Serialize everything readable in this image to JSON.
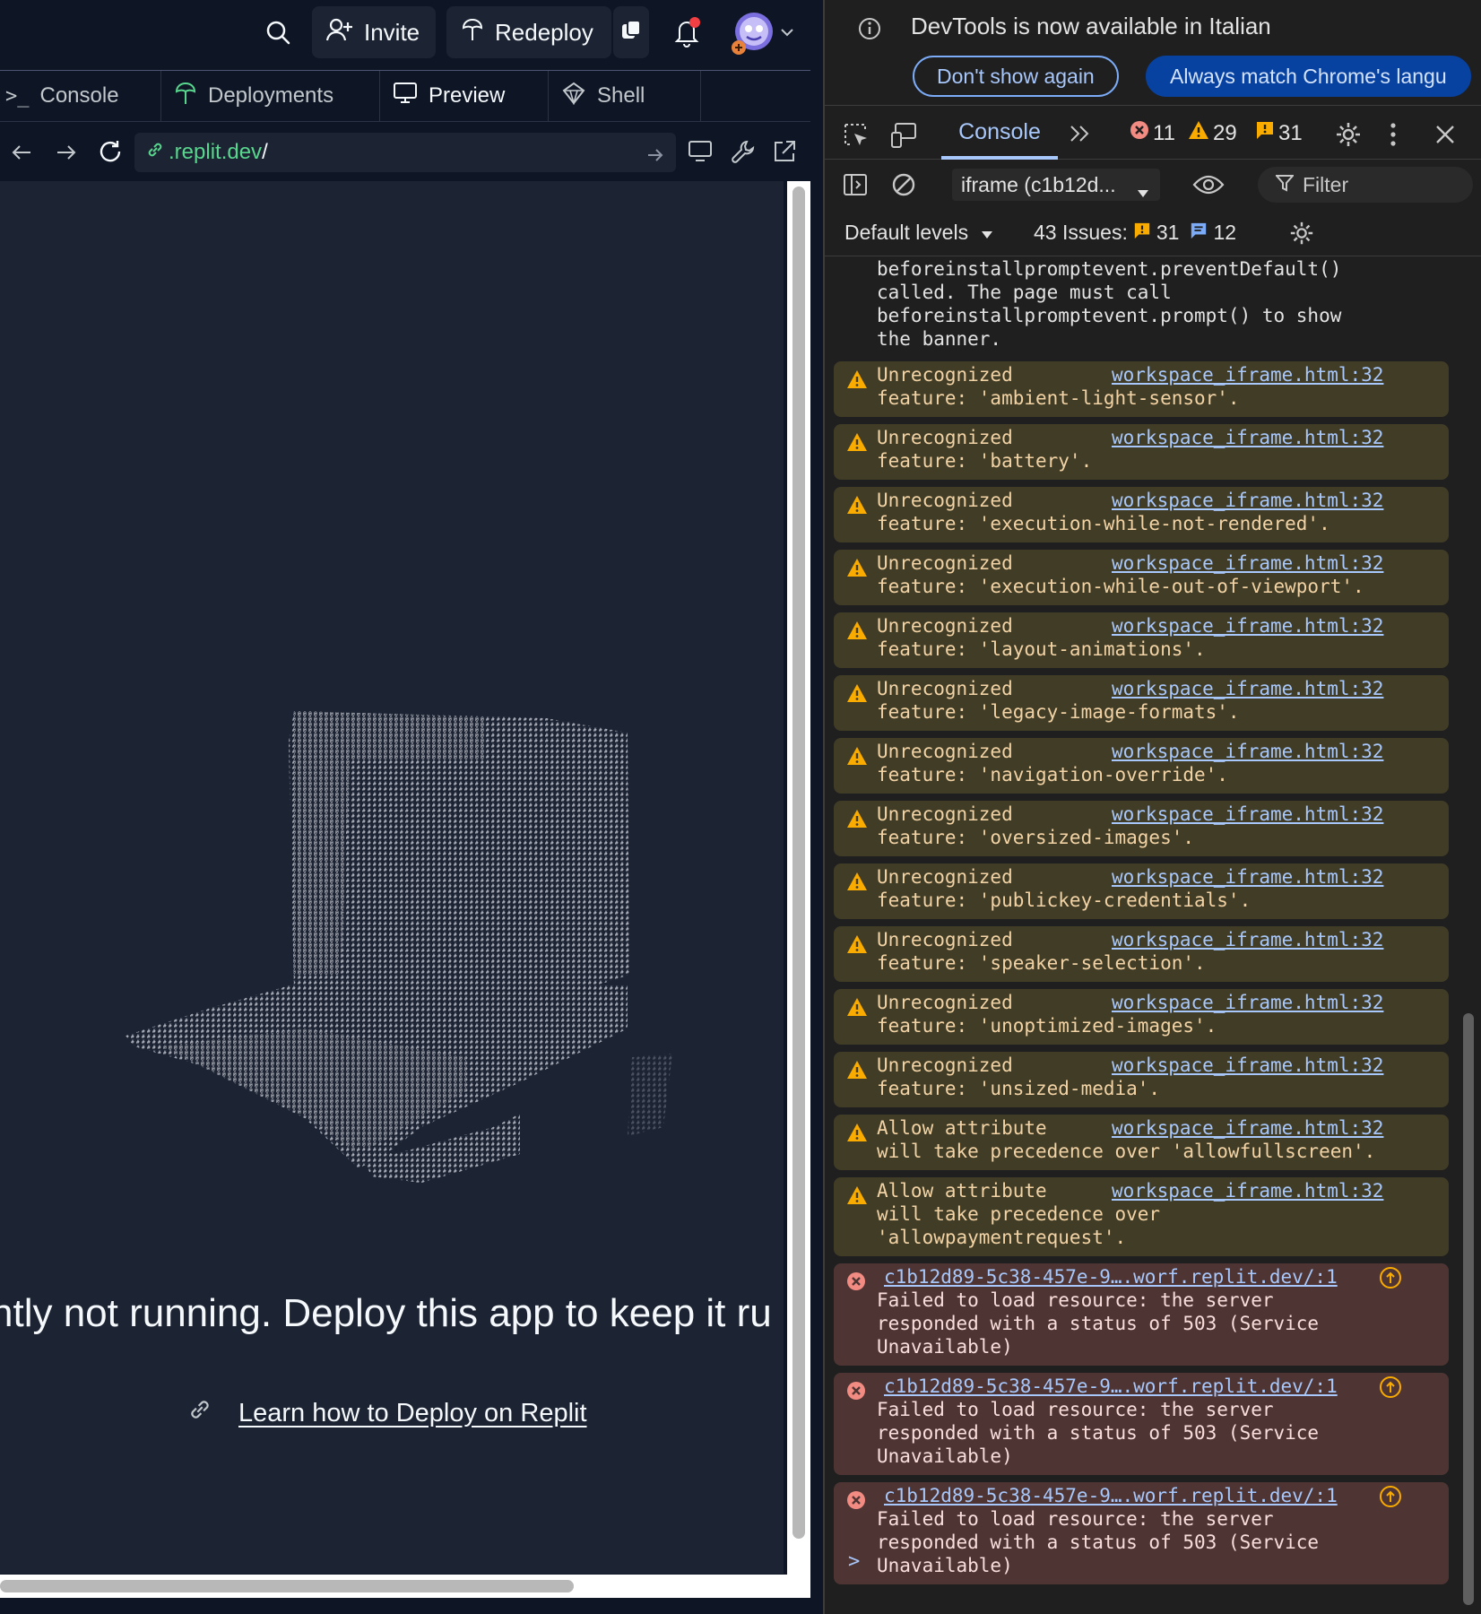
{
  "replit": {
    "topbar": {
      "invite_label": "Invite",
      "redeploy_label": "Redeploy"
    },
    "tabs": [
      {
        "label": "Console",
        "icon": "terminal-icon"
      },
      {
        "label": "Deployments",
        "icon": "deployments-icon"
      },
      {
        "label": "Preview",
        "icon": "monitor-icon"
      },
      {
        "label": "Shell",
        "icon": "shell-icon"
      }
    ],
    "active_tab": "Preview",
    "url": {
      "host": ".replit.dev",
      "path": "/"
    },
    "preview": {
      "message": "ntly not running. Deploy this app to keep it ru",
      "learn_link": "Learn how to Deploy on Replit"
    }
  },
  "devtools": {
    "infobar": {
      "text": "DevTools is now available in Italian",
      "dont_show": "Don't show again",
      "match_lang": "Always match Chrome's langu"
    },
    "toolbar": {
      "console_tab": "Console",
      "errors": "11",
      "warnings": "29",
      "issues": "31"
    },
    "filterbar": {
      "context": "iframe (c1b12d...",
      "filter_placeholder": "Filter"
    },
    "levels": {
      "label": "Default levels",
      "issues_label": "43 Issues:",
      "issues_warn": "31",
      "issues_info": "12"
    },
    "first_message": "beforeinstallpromptevent.preventDefault()\ncalled. The page must call\nbeforeinstallpromptevent.prompt() to show\nthe banner.",
    "messages": [
      {
        "level": "warn",
        "text": "Unrecognized\nfeature: 'ambient-light-sensor'.",
        "source": "workspace_iframe.html:32"
      },
      {
        "level": "warn",
        "text": "Unrecognized\nfeature: 'battery'.",
        "source": "workspace_iframe.html:32"
      },
      {
        "level": "warn",
        "text": "Unrecognized\nfeature: 'execution-while-not-rendered'.",
        "source": "workspace_iframe.html:32"
      },
      {
        "level": "warn",
        "text": "Unrecognized\nfeature: 'execution-while-out-of-viewport'.",
        "source": "workspace_iframe.html:32"
      },
      {
        "level": "warn",
        "text": "Unrecognized\nfeature: 'layout-animations'.",
        "source": "workspace_iframe.html:32"
      },
      {
        "level": "warn",
        "text": "Unrecognized\nfeature: 'legacy-image-formats'.",
        "source": "workspace_iframe.html:32"
      },
      {
        "level": "warn",
        "text": "Unrecognized\nfeature: 'navigation-override'.",
        "source": "workspace_iframe.html:32"
      },
      {
        "level": "warn",
        "text": "Unrecognized\nfeature: 'oversized-images'.",
        "source": "workspace_iframe.html:32"
      },
      {
        "level": "warn",
        "text": "Unrecognized\nfeature: 'publickey-credentials'.",
        "source": "workspace_iframe.html:32"
      },
      {
        "level": "warn",
        "text": "Unrecognized\nfeature: 'speaker-selection'.",
        "source": "workspace_iframe.html:32"
      },
      {
        "level": "warn",
        "text": "Unrecognized\nfeature: 'unoptimized-images'.",
        "source": "workspace_iframe.html:32"
      },
      {
        "level": "warn",
        "text": "Unrecognized\nfeature: 'unsized-media'.",
        "source": "workspace_iframe.html:32"
      },
      {
        "level": "warn",
        "text": "Allow attribute\nwill take precedence over 'allowfullscreen'.",
        "source": "workspace_iframe.html:32"
      },
      {
        "level": "warn",
        "text": "Allow attribute\nwill take precedence over\n'allowpaymentrequest'.",
        "source": "workspace_iframe.html:32"
      },
      {
        "level": "error",
        "text": "\nFailed to load resource: the server\nresponded with a status of 503 (Service\nUnavailable)",
        "source": "c1b12d89-5c38-457e-9….worf.replit.dev/:1"
      },
      {
        "level": "error",
        "text": "\nFailed to load resource: the server\nresponded with a status of 503 (Service\nUnavailable)",
        "source": "c1b12d89-5c38-457e-9….worf.replit.dev/:1"
      },
      {
        "level": "error",
        "text": "\nFailed to load resource: the server\nresponded with a status of 503 (Service\nUnavailable)",
        "source": "c1b12d89-5c38-457e-9….worf.replit.dev/:1"
      }
    ],
    "prompt": ">"
  },
  "colors": {
    "replit_bg": "#0e1525",
    "replit_panel": "#1c2333",
    "devtools_bg": "#1f1f1f",
    "warn_bg": "#413c26",
    "error_bg": "#4e3534",
    "link": "#a8c7fa",
    "url_green": "#58d68d",
    "error_red": "#f28b82",
    "warn_orange": "#f9ab00"
  }
}
